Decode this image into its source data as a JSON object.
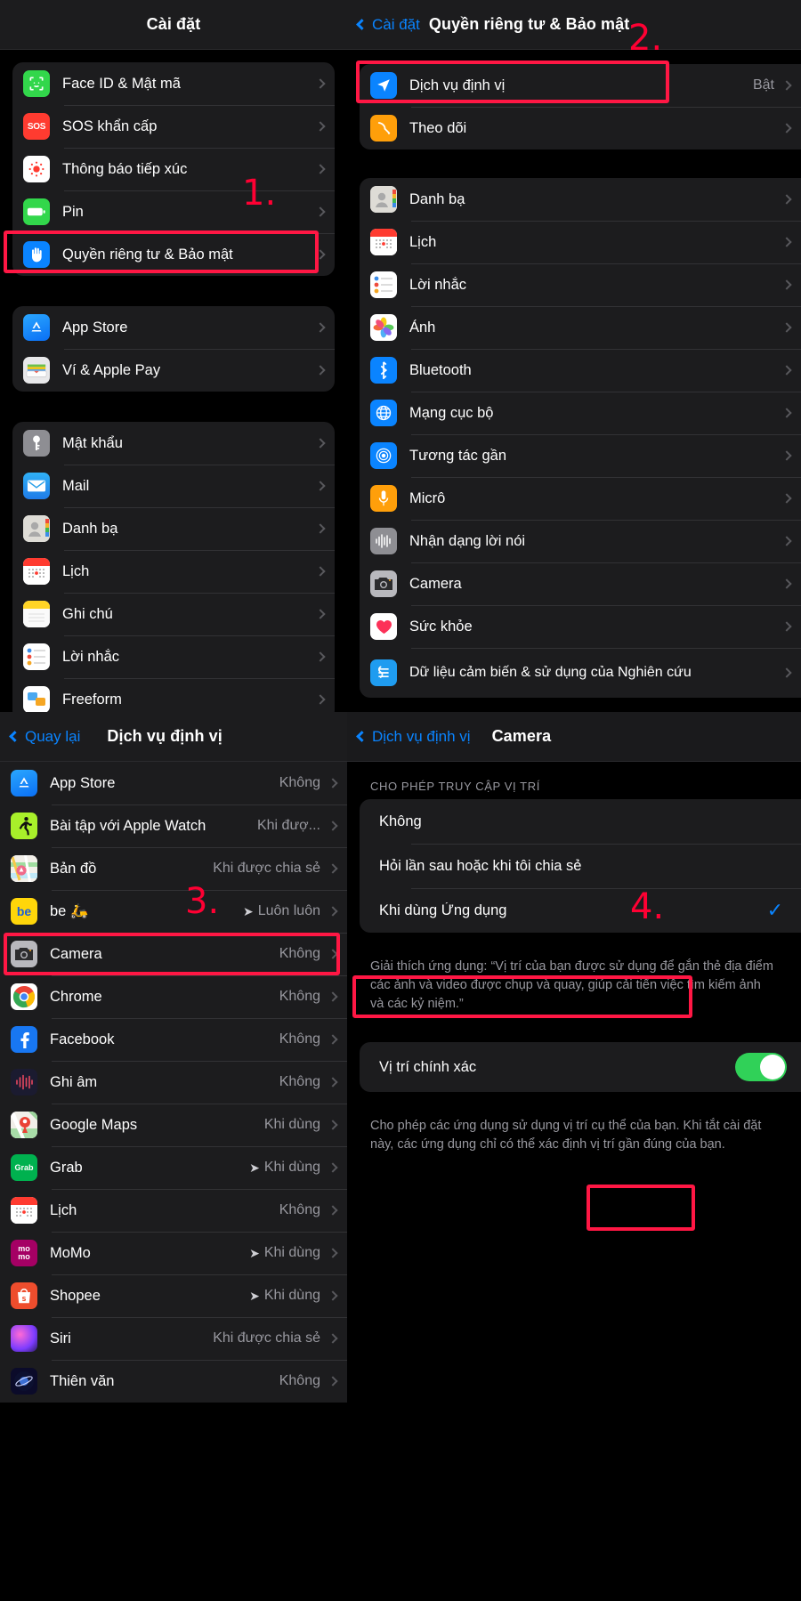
{
  "panels": {
    "settings": {
      "title": "Cài đặt",
      "step_marker": "1.",
      "groups": [
        {
          "rows": [
            {
              "label": "Face ID & Mật mã",
              "icon": "faceid-icon",
              "value": "",
              "chevron": true
            },
            {
              "label": "SOS khẩn cấp",
              "icon": "sos-icon",
              "value": "",
              "chevron": true
            },
            {
              "label": "Thông báo tiếp xúc",
              "icon": "exposure-notification-icon",
              "value": "",
              "chevron": true
            },
            {
              "label": "Pin",
              "icon": "battery-icon",
              "value": "",
              "chevron": true
            },
            {
              "label": "Quyền riêng tư & Bảo mật",
              "icon": "privacy-hand-icon",
              "value": "",
              "chevron": true,
              "highlight": true
            }
          ]
        },
        {
          "rows": [
            {
              "label": "App Store",
              "icon": "app-store-icon",
              "value": "",
              "chevron": true
            },
            {
              "label": "Ví & Apple Pay",
              "icon": "wallet-icon",
              "value": "",
              "chevron": true
            }
          ]
        },
        {
          "rows": [
            {
              "label": "Mật khẩu",
              "icon": "key-icon",
              "value": "",
              "chevron": true
            },
            {
              "label": "Mail",
              "icon": "mail-icon",
              "value": "",
              "chevron": true
            },
            {
              "label": "Danh bạ",
              "icon": "contacts-icon",
              "value": "",
              "chevron": true
            },
            {
              "label": "Lịch",
              "icon": "calendar-icon",
              "value": "",
              "chevron": true
            },
            {
              "label": "Ghi chú",
              "icon": "notes-icon",
              "value": "",
              "chevron": true
            },
            {
              "label": "Lời nhắc",
              "icon": "reminders-icon",
              "value": "",
              "chevron": true
            },
            {
              "label": "Freeform",
              "icon": "freeform-icon",
              "value": "",
              "chevron": true
            }
          ]
        }
      ]
    },
    "privacy": {
      "back_label": "Cài đặt",
      "title": "Quyền riêng tư & Bảo mật",
      "step_marker": "2.",
      "groups": [
        {
          "rows": [
            {
              "label": "Dịch vụ định vị",
              "icon": "location-services-icon",
              "value": "Bật",
              "chevron": true,
              "highlight": true
            },
            {
              "label": "Theo dõi",
              "icon": "tracking-icon",
              "value": "",
              "chevron": true
            }
          ]
        },
        {
          "rows": [
            {
              "label": "Danh bạ",
              "icon": "contacts-icon",
              "value": "",
              "chevron": true
            },
            {
              "label": "Lịch",
              "icon": "calendar-icon",
              "value": "",
              "chevron": true
            },
            {
              "label": "Lời nhắc",
              "icon": "reminders-icon",
              "value": "",
              "chevron": true
            },
            {
              "label": "Ảnh",
              "icon": "photos-icon",
              "value": "",
              "chevron": true
            },
            {
              "label": "Bluetooth",
              "icon": "bluetooth-icon",
              "value": "",
              "chevron": true
            },
            {
              "label": "Mạng cục bộ",
              "icon": "local-network-icon",
              "value": "",
              "chevron": true
            },
            {
              "label": "Tương tác gần",
              "icon": "nearby-interactions-icon",
              "value": "",
              "chevron": true
            },
            {
              "label": "Micrô",
              "icon": "microphone-icon",
              "value": "",
              "chevron": true
            },
            {
              "label": "Nhận dạng lời nói",
              "icon": "speech-recognition-icon",
              "value": "",
              "chevron": true
            },
            {
              "label": "Camera",
              "icon": "camera-icon",
              "value": "",
              "chevron": true
            },
            {
              "label": "Sức khỏe",
              "icon": "health-icon",
              "value": "",
              "chevron": true
            },
            {
              "label": "Dữ liệu cảm biến & sử dụng của Nghiên cứu",
              "icon": "research-sensor-icon",
              "value": "",
              "chevron": true
            }
          ]
        }
      ]
    },
    "location_services": {
      "back_label": "Quay lại",
      "title": "Dịch vụ định vị",
      "step_marker": "3.",
      "rows": [
        {
          "label": "App Store",
          "icon": "app-store-icon",
          "value": "Không",
          "arrow": false
        },
        {
          "label": "Bài tập với Apple Watch",
          "icon": "fitness-icon",
          "value": "Khi đượ...",
          "arrow": false
        },
        {
          "label": "Bản đồ",
          "icon": "maps-icon",
          "value": "Khi được chia sẻ",
          "arrow": false
        },
        {
          "label": "be 🛵",
          "icon": "be-app-icon",
          "value": "Luôn luôn",
          "arrow": true
        },
        {
          "label": "Camera",
          "icon": "camera-icon",
          "value": "Không",
          "arrow": false,
          "highlight": true
        },
        {
          "label": "Chrome",
          "icon": "chrome-icon",
          "value": "Không",
          "arrow": false
        },
        {
          "label": "Facebook",
          "icon": "facebook-icon",
          "value": "Không",
          "arrow": false
        },
        {
          "label": "Ghi âm",
          "icon": "voice-memos-icon",
          "value": "Không",
          "arrow": false
        },
        {
          "label": "Google Maps",
          "icon": "google-maps-icon",
          "value": "Khi dùng",
          "arrow": false
        },
        {
          "label": "Grab",
          "icon": "grab-icon",
          "value": "Khi dùng",
          "arrow": true
        },
        {
          "label": "Lịch",
          "icon": "calendar-icon",
          "value": "Không",
          "arrow": false
        },
        {
          "label": "MoMo",
          "icon": "momo-icon",
          "value": "Khi dùng",
          "arrow": true
        },
        {
          "label": "Shopee",
          "icon": "shopee-icon",
          "value": "Khi dùng",
          "arrow": true
        },
        {
          "label": "Siri",
          "icon": "siri-icon",
          "value": "Khi được chia sẻ",
          "arrow": false
        },
        {
          "label": "Thiên văn",
          "icon": "astronomy-icon",
          "value": "Không",
          "arrow": false
        }
      ]
    },
    "camera_location": {
      "back_label": "Dịch vụ định vị",
      "title": "Camera",
      "step_marker": "4.",
      "section_header": "CHO PHÉP TRUY CẬP VỊ TRÍ",
      "options": [
        {
          "label": "Không",
          "selected": false
        },
        {
          "label": "Hỏi lần sau hoặc khi tôi chia sẻ",
          "selected": false
        },
        {
          "label": "Khi dùng Ứng dụng",
          "selected": true,
          "highlight": true
        }
      ],
      "explanation": "Giải thích ứng dụng: “Vị trí của bạn được sử dụng để gắn thẻ địa điểm các ảnh và video được chụp và quay, giúp cải tiến việc tìm kiếm ảnh và các kỷ niệm.”",
      "precise": {
        "label": "Vị trí chính xác",
        "enabled": true
      },
      "precise_footnote": "Cho phép các ứng dụng sử dụng vị trí cụ thể của bạn. Khi tắt cài đặt này, các ứng dụng chỉ có thể xác định vị trí gần đúng của bạn."
    }
  },
  "colors": {
    "accent_blue": "#0a84ff",
    "highlight_red": "#ff1744",
    "toggle_green": "#30d158",
    "group_bg": "#1c1c1e",
    "value_gray": "#98989f"
  }
}
